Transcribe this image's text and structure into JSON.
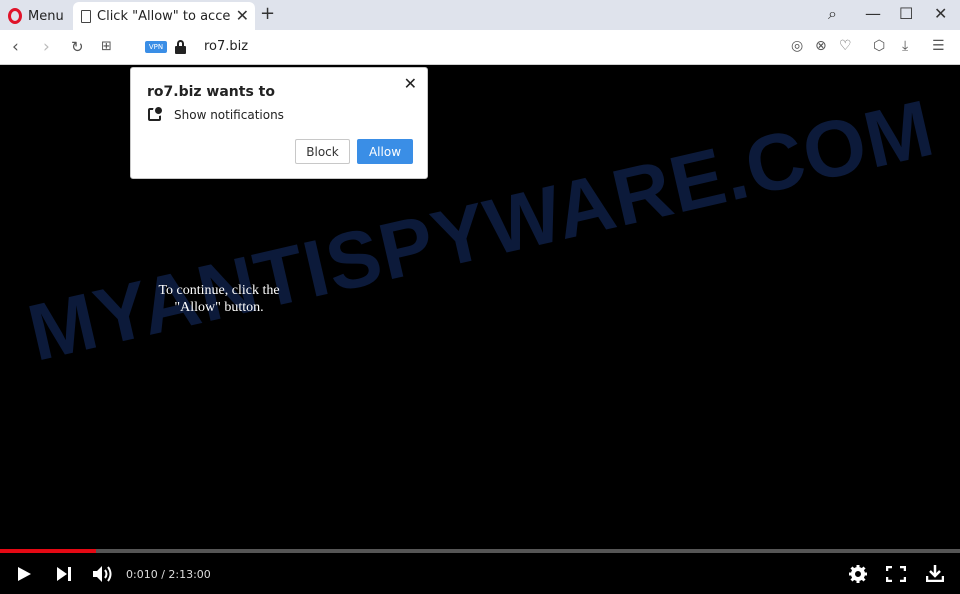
{
  "browser": {
    "menu_label": "Menu",
    "tab_title": "Click \"Allow\" to access",
    "url": "ro7.biz",
    "vpn_label": "VPN"
  },
  "popup": {
    "title": "ro7.biz wants to",
    "permission": "Show notifications",
    "block_label": "Block",
    "allow_label": "Allow"
  },
  "page": {
    "instruction": "To continue, click the \"Allow\" button.",
    "watermark": "MYANTISPYWARE.COM"
  },
  "player": {
    "time": "0:010 / 2:13:00",
    "progress": 0.1
  },
  "colors": {
    "accent": "#3a8ee6",
    "progress": "#e50914",
    "opera_red": "#e0142a"
  }
}
